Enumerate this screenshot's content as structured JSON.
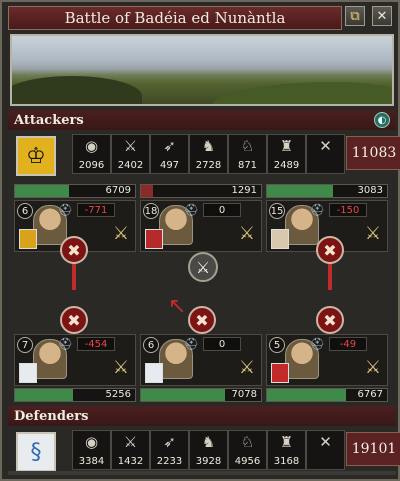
{
  "window": {
    "title": "Battle of Badéia ed Nunàntla"
  },
  "attackers": {
    "label": "Attackers",
    "total": "11083",
    "units": [
      {
        "icon": "shield-icon",
        "glyph": "◉",
        "value": "2096"
      },
      {
        "icon": "axes-icon",
        "glyph": "⚔",
        "value": "2402"
      },
      {
        "icon": "bow-icon",
        "glyph": "➶",
        "value": "497"
      },
      {
        "icon": "cavalry-icon",
        "glyph": "♞",
        "value": "2728"
      },
      {
        "icon": "horse-archer-icon",
        "glyph": "♘",
        "value": "871"
      },
      {
        "icon": "knight-icon",
        "glyph": "♜",
        "value": "2489"
      },
      {
        "icon": "special-icon",
        "glyph": "✕",
        "value": ""
      }
    ],
    "flanks": [
      {
        "strength": "6709",
        "fill_fraction": 0.45,
        "fill_color": "#3f8a48",
        "level": "6",
        "loss": "-771"
      },
      {
        "strength": "1291",
        "fill_fraction": 0.1,
        "fill_color": "#8a2a2a",
        "level": "18",
        "loss": "0"
      },
      {
        "strength": "3083",
        "fill_fraction": 0.55,
        "fill_color": "#3f8a48",
        "level": "15",
        "loss": "-150"
      }
    ]
  },
  "defenders": {
    "label": "Defenders",
    "total": "19101",
    "units": [
      {
        "icon": "shield-icon",
        "glyph": "◉",
        "value": "3384"
      },
      {
        "icon": "axes-icon",
        "glyph": "⚔",
        "value": "1432"
      },
      {
        "icon": "bow-icon",
        "glyph": "➶",
        "value": "2233"
      },
      {
        "icon": "cavalry-icon",
        "glyph": "♞",
        "value": "3928"
      },
      {
        "icon": "horse-archer-icon",
        "glyph": "♘",
        "value": "4956"
      },
      {
        "icon": "knight-icon",
        "glyph": "♜",
        "value": "3168"
      },
      {
        "icon": "special-icon",
        "glyph": "✕",
        "value": ""
      }
    ],
    "flanks": [
      {
        "strength": "5256",
        "fill_fraction": 0.48,
        "fill_color": "#3f8a48",
        "level": "7",
        "loss": "-454"
      },
      {
        "strength": "7078",
        "fill_fraction": 0.7,
        "fill_color": "#3f8a48",
        "level": "6",
        "loss": "0"
      },
      {
        "strength": "6767",
        "fill_fraction": 0.66,
        "fill_color": "#3f8a48",
        "level": "5",
        "loss": "-49"
      }
    ]
  },
  "icons": {
    "minimize": "⧉",
    "close": "✕",
    "globe": "◐",
    "engage": "✖",
    "retreat": "↖",
    "helmet": "⛑",
    "sword": "⚔"
  }
}
